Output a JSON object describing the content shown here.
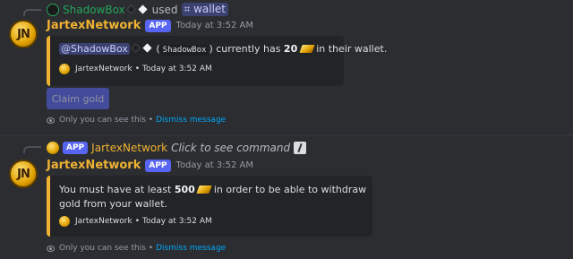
{
  "msg1": {
    "reply_user": "ShadowBox",
    "reply_used": "used",
    "reply_command": "⌗ wallet",
    "author": "JartexNetwork",
    "app_badge": "APP",
    "timestamp": "Today at 3:52 AM",
    "embed": {
      "mention": "@ShadowBox",
      "code_name": "ShadowBox",
      "text_pre": "currently has",
      "amount": "20",
      "text_post": "in their wallet.",
      "footer_author": "JartexNetwork",
      "footer_time": "Today at 3:52 AM"
    },
    "button_label": "Claim gold",
    "ephemeral_text": "Only you can see this •",
    "dismiss_label": "Dismiss message"
  },
  "msg2": {
    "reply_app_badge": "APP",
    "reply_user": "JartexNetwork",
    "reply_hint": "Click to see command",
    "author": "JartexNetwork",
    "app_badge": "APP",
    "timestamp": "Today at 3:52 AM",
    "embed": {
      "text_pre": "You must have at least",
      "amount": "500",
      "text_post": "in order to be able to withdraw gold from your",
      "text_line2": "wallet.",
      "footer_author": "JartexNetwork",
      "footer_time": "Today at 3:52 AM"
    },
    "ephemeral_text": "Only you can see this •",
    "dismiss_label": "Dismiss message"
  },
  "colors": {
    "accent": "#f0b232",
    "blurple": "#5865f2",
    "link": "#00a8fc",
    "background": "#313338"
  }
}
